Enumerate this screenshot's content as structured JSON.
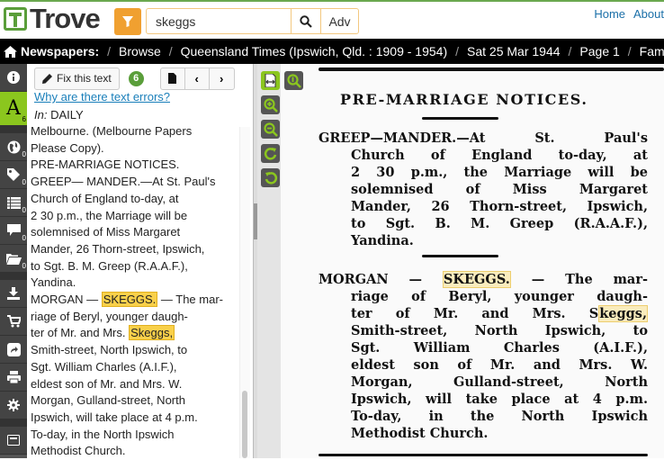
{
  "header": {
    "logo_text": "Trove",
    "search_value": "skeggs",
    "adv_label": "Adv",
    "links": [
      "Home",
      "About"
    ]
  },
  "breadcrumb": {
    "root": "Newspapers:",
    "items": [
      "Browse",
      "Queensland Times (Ipswich, Qld. : 1909 - 1954)",
      "Sat 25 Mar 1944",
      "Page 1",
      "Family Notices"
    ]
  },
  "sidebar": {
    "items": [
      {
        "icon": "info-icon",
        "count": ""
      },
      {
        "icon": "text-icon",
        "label": "A",
        "count": "6"
      },
      {
        "icon": "globe-icon",
        "count": "0"
      },
      {
        "icon": "tag-icon",
        "count": "0"
      },
      {
        "icon": "list-icon",
        "count": "0"
      },
      {
        "icon": "comment-icon",
        "count": "0"
      },
      {
        "icon": "folder-icon",
        "count": "0"
      },
      {
        "icon": "download-icon",
        "count": ""
      },
      {
        "icon": "cart-icon",
        "count": ""
      },
      {
        "icon": "share-icon",
        "count": ""
      },
      {
        "icon": "print-icon",
        "count": ""
      },
      {
        "icon": "settings-icon",
        "count": ""
      }
    ]
  },
  "textpanel": {
    "fix_label": "Fix this text",
    "fix_count": "6",
    "why_link": "Why are there text errors?",
    "in_label": "In:",
    "in_value": "DAILY",
    "lines": [
      "Melbourne. (Melbourne Papers",
      "Please Copy).",
      "PRE-MARRIAGE NOTICES.",
      "GREEP— MANDER.—At St. Paul's",
      "Church of England to-day, at",
      "2 30 p.m., the Marriage will be",
      "solemnised of Miss Margaret",
      "Mander, 26 Thorn-street, Ipswich,",
      "to Sgt. B. M. Greep (R.A.A.F.),",
      "Yandina."
    ],
    "morgan_pre": "MORGAN — ",
    "morgan_hl": "SKEGGS.",
    "morgan_post": " — The mar-",
    "line_riage": "riage of Beryl, younger daugh-",
    "ter_pre": "ter of Mr. and Mrs. ",
    "ter_hl": "Skeggs,",
    "rest": [
      "Smith-street, North Ipswich, to",
      "Sgt. William Charles (A.I.F.),",
      "eldest son of Mr. and Mrs. W.",
      "Morgan, Gulland-street, North",
      "Ipswich, will take place at 4 p.m.",
      "To-day, in the North Ipswich",
      "Methodist Church."
    ]
  },
  "newspaper": {
    "heading": "PRE-MARRIAGE NOTICES.",
    "p1": [
      "GREEP—MANDER.—At St. Paul's",
      "Church of England to-day, at",
      "2 30 p.m., the Marriage will be",
      "solemnised of Miss Margaret",
      "Mander, 26 Thorn-street, Ipswich,",
      "to Sgt. B. M. Greep (R.A.A.F.),",
      "Yandina."
    ],
    "p2_first_pre": "MORGAN — ",
    "p2_first_hl": "SKEGGS.",
    "p2_first_post": " — The mar-",
    "p2_line2": "riage of Beryl, younger daugh-",
    "p2_line3_pre": "ter of Mr. and Mrs. S",
    "p2_line3_hl": "keggs,",
    "p2_rest": [
      "Smith-street, North Ipswich, to",
      "Sgt. William Charles (A.I.F.),",
      "eldest son of Mr. and Mrs. W.",
      "Morgan, Gulland-street, North",
      "Ipswich, will take place at 4 p.m.",
      "To-day, in the North Ipswich",
      "Methodist Church."
    ]
  },
  "colors": {
    "brand_green": "#5a9e3a",
    "active_green": "#8bc61e",
    "filter_orange": "#f0a030",
    "highlight": "#f9d04a",
    "link": "#1a7fba"
  }
}
